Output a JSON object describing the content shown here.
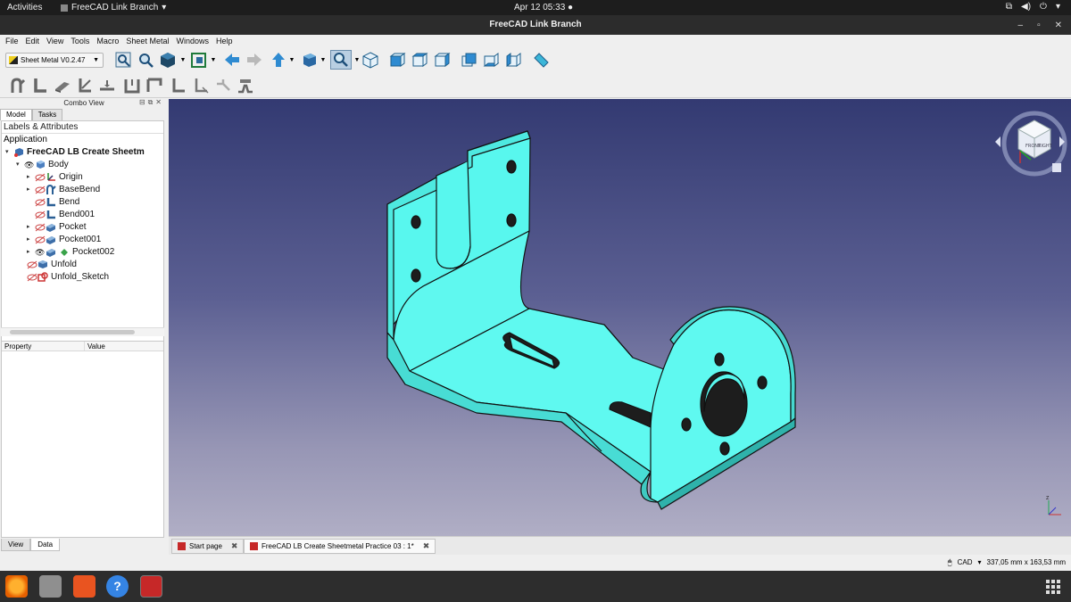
{
  "system": {
    "activities": "Activities",
    "app_name": "FreeCAD Link Branch",
    "clock": "Apr 12  05:33"
  },
  "window": {
    "title": "FreeCAD Link Branch"
  },
  "menu": [
    "File",
    "Edit",
    "View",
    "Tools",
    "Macro",
    "Sheet Metal",
    "Windows",
    "Help"
  ],
  "toolbar": {
    "workbench": "Sheet Metal V0.2.47"
  },
  "combo": {
    "title": "Combo View",
    "tabs": [
      "Model",
      "Tasks"
    ],
    "tree_header": "Labels & Attributes",
    "application": "Application",
    "tree": [
      {
        "label": "FreeCAD LB Create Sheetm",
        "bold": true
      },
      {
        "label": "Body"
      },
      {
        "label": "Origin"
      },
      {
        "label": "BaseBend"
      },
      {
        "label": "Bend"
      },
      {
        "label": "Bend001"
      },
      {
        "label": "Pocket"
      },
      {
        "label": "Pocket001"
      },
      {
        "label": "Pocket002"
      },
      {
        "label": "Unfold"
      },
      {
        "label": "Unfold_Sketch"
      }
    ],
    "prop_headers": [
      "Property",
      "Value"
    ],
    "view_tabs": [
      "View",
      "Data"
    ]
  },
  "doc_tabs": [
    {
      "label": "Start page"
    },
    {
      "label": "FreeCAD LB Create Sheetmetal Practice 03 : 1*"
    }
  ],
  "status": {
    "nav_style": "CAD",
    "dimensions": "337,05 mm x 163,53 mm"
  },
  "colors": {
    "model_face": "#55f7ee",
    "viewport_top": "#333a72",
    "viewport_bottom": "#b0aec5"
  }
}
